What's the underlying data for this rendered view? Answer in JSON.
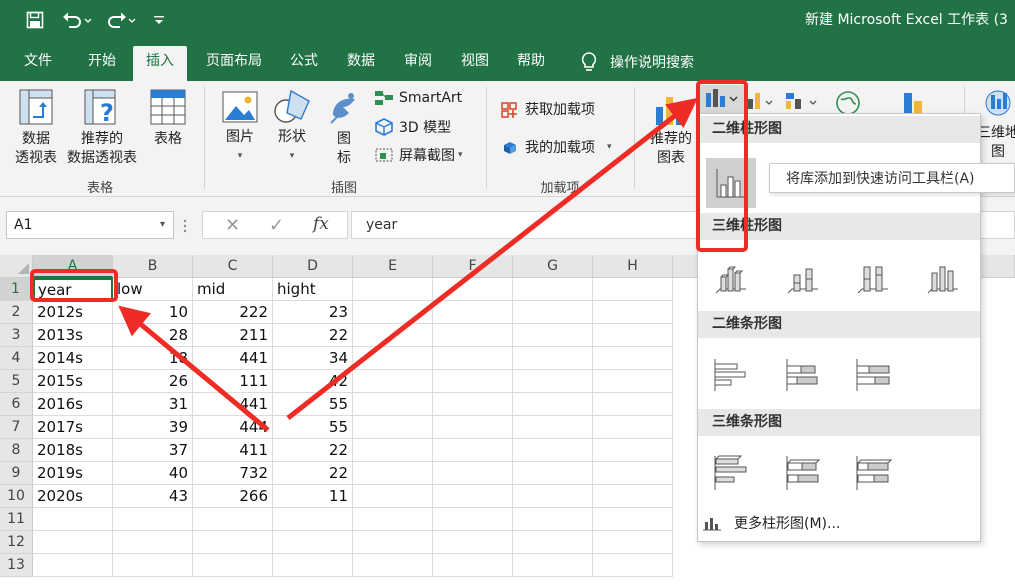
{
  "window": {
    "title": "新建 Microsoft Excel 工作表 (3",
    "accent": "#217346"
  },
  "quick_access": [
    {
      "icon": "save-icon"
    },
    {
      "icon": "undo-icon"
    },
    {
      "icon": "redo-icon"
    },
    {
      "icon": "customize-qat-icon"
    }
  ],
  "tabs": [
    {
      "label": "文件"
    },
    {
      "label": "开始"
    },
    {
      "label": "插入",
      "active": true
    },
    {
      "label": "页面布局"
    },
    {
      "label": "公式"
    },
    {
      "label": "数据"
    },
    {
      "label": "审阅"
    },
    {
      "label": "视图"
    },
    {
      "label": "帮助"
    }
  ],
  "tell_me": {
    "label": "操作说明搜索"
  },
  "ribbon": {
    "tables": {
      "pivot_line1": "数据",
      "pivot_line2": "透视表",
      "rec_pivot_line1": "推荐的",
      "rec_pivot_line2": "数据透视表",
      "table": "表格",
      "group": "表格"
    },
    "illustrations": {
      "pictures": "图片",
      "shapes": "形状",
      "icons_line1": "图",
      "icons_line2": "标",
      "smartart": "SmartArt",
      "model3d": "3D 模型",
      "screenshot": "屏幕截图",
      "group": "插图"
    },
    "addins": {
      "get": "获取加载项",
      "my": "我的加载项",
      "group": "加载项"
    },
    "charts": {
      "rec_line1": "推荐的",
      "rec_line2": "图表",
      "map3d_line1": "三维地",
      "map3d_line2": "图"
    }
  },
  "name_box": {
    "value": "A1"
  },
  "formula_bar": {
    "value": "year"
  },
  "sheet": {
    "columns": [
      "A",
      "B",
      "C",
      "D",
      "E",
      "F",
      "G",
      "H"
    ],
    "rows": [
      "1",
      "2",
      "3",
      "4",
      "5",
      "6",
      "7",
      "8",
      "9",
      "10",
      "11",
      "12",
      "13"
    ],
    "header": [
      "year",
      "low",
      "mid",
      "hight"
    ],
    "data": [
      [
        "2012s",
        "10",
        "222",
        "23"
      ],
      [
        "2013s",
        "28",
        "211",
        "22"
      ],
      [
        "2014s",
        "18",
        "441",
        "34"
      ],
      [
        "2015s",
        "26",
        "111",
        "42"
      ],
      [
        "2016s",
        "31",
        "441",
        "55"
      ],
      [
        "2017s",
        "39",
        "444",
        "55"
      ],
      [
        "2018s",
        "37",
        "411",
        "22"
      ],
      [
        "2019s",
        "40",
        "732",
        "22"
      ],
      [
        "2020s",
        "43",
        "266",
        "11"
      ]
    ]
  },
  "chart_menu": {
    "sections": [
      "二维柱形图",
      "三维柱形图",
      "二维条形图",
      "三维条形图"
    ],
    "more": "更多柱形图(M)...",
    "tooltip": "将库添加到快速访问工具栏(A)"
  },
  "annotation": {
    "color": "#ee2b24"
  }
}
